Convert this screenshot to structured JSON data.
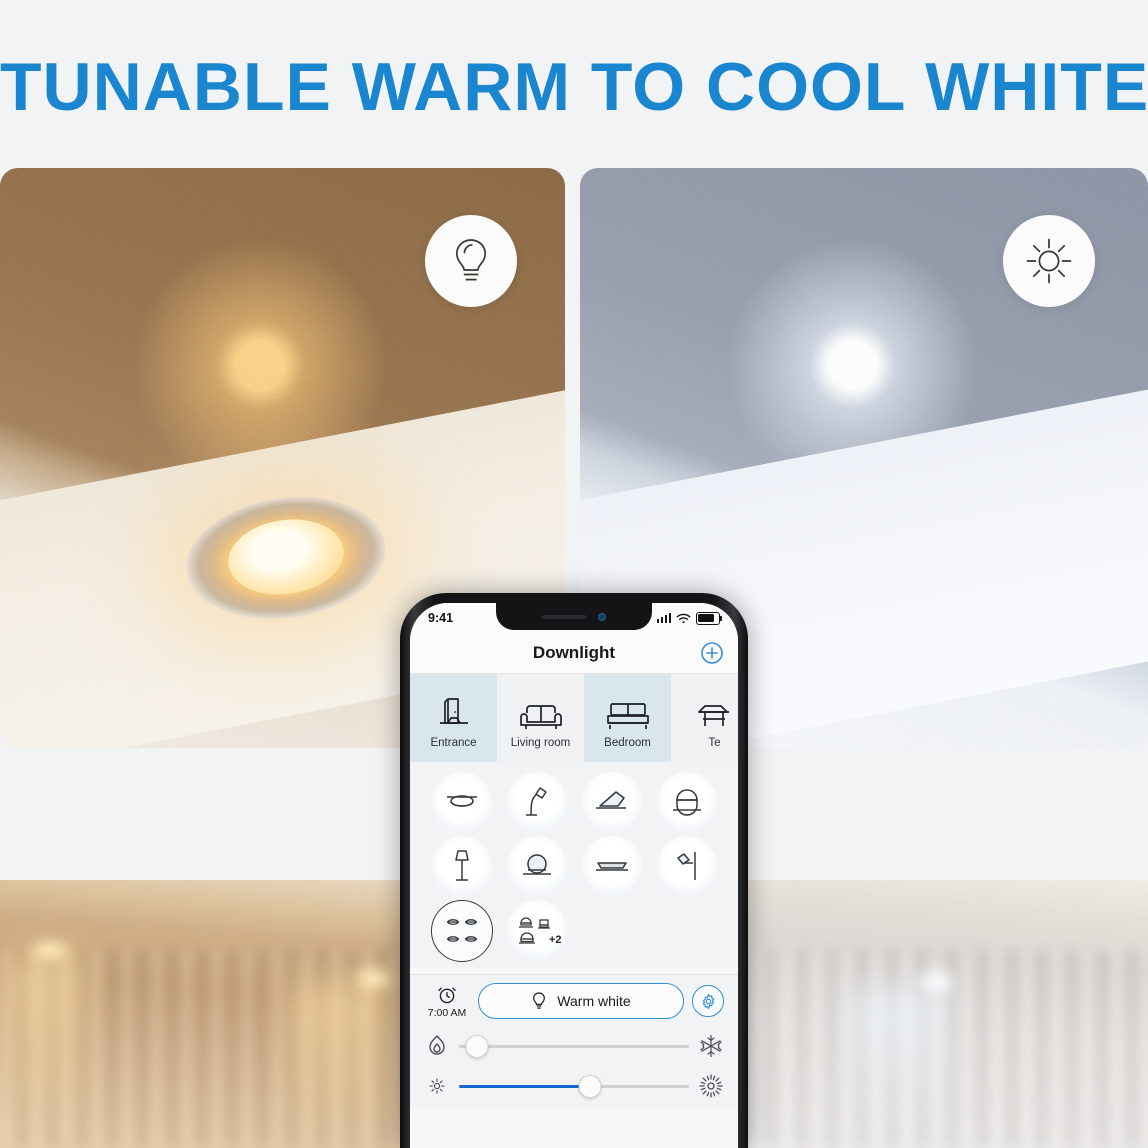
{
  "headline": "TUNABLE WARM TO COOL WHITE",
  "hero": {
    "left_panel": {
      "name": "warm-white-ceiling-photo",
      "badge_icon": "bulb-icon",
      "tone": "warm",
      "color": "#8d6b46"
    },
    "right_panel": {
      "name": "cool-white-ceiling-photo",
      "badge_icon": "sun-icon",
      "tone": "cool",
      "color": "#8e96a7"
    }
  },
  "rooms": {
    "left": {
      "name": "warm-lit-room-photo"
    },
    "right": {
      "name": "cool-lit-room-photo"
    }
  },
  "phone": {
    "status_bar": {
      "time": "9:41",
      "signal_icon": "cellular-signal-icon",
      "wifi_icon": "wifi-icon",
      "battery_icon": "battery-icon"
    },
    "nav": {
      "title": "Downlight",
      "add_label": "+",
      "add_icon": "add-circle-icon"
    },
    "tabs": [
      {
        "label": "Entrance",
        "icon": "door-icon",
        "active": true
      },
      {
        "label": "Living room",
        "icon": "sofa-icon",
        "active": false
      },
      {
        "label": "Bedroom",
        "icon": "bed-icon",
        "active": true
      },
      {
        "label": "Te",
        "icon": "table-chair-icon",
        "active": false
      }
    ],
    "devices": [
      {
        "icon": "ceiling-light-icon",
        "selected": false
      },
      {
        "icon": "desk-lamp-icon",
        "selected": false
      },
      {
        "icon": "wedge-panel-icon",
        "selected": false
      },
      {
        "icon": "dome-light-icon",
        "selected": false
      },
      {
        "icon": "floor-lamp-icon",
        "selected": false
      },
      {
        "icon": "globe-lamp-icon",
        "selected": false
      },
      {
        "icon": "linear-strip-icon",
        "selected": false
      },
      {
        "icon": "wall-sconce-icon",
        "selected": false
      },
      {
        "icon": "downlight-group-icon",
        "selected": true
      },
      {
        "icon": "lamp-group-icon",
        "selected": false,
        "extra_count": "+2"
      }
    ],
    "controls": {
      "alarm_icon": "alarm-clock-icon",
      "alarm_time": "7:00 AM",
      "scene_label": "Warm white",
      "scene_icon": "bulb-icon",
      "settings_icon": "gear-icon",
      "temperature_slider": {
        "name": "color-temperature-slider",
        "left_icon": "flame-icon",
        "right_icon": "snowflake-icon",
        "value_percent": 8,
        "fill_percent": 0
      },
      "brightness_slider": {
        "name": "brightness-slider",
        "left_icon": "small-sun-icon",
        "right_icon": "large-sun-icon",
        "value_percent": 57,
        "fill_percent": 57
      }
    }
  },
  "colors": {
    "accent_blue": "#1a86d0",
    "slider_blue": "#1268d0",
    "tab_active": "#d9e7ec",
    "page_bg": "#f2f3f4"
  }
}
